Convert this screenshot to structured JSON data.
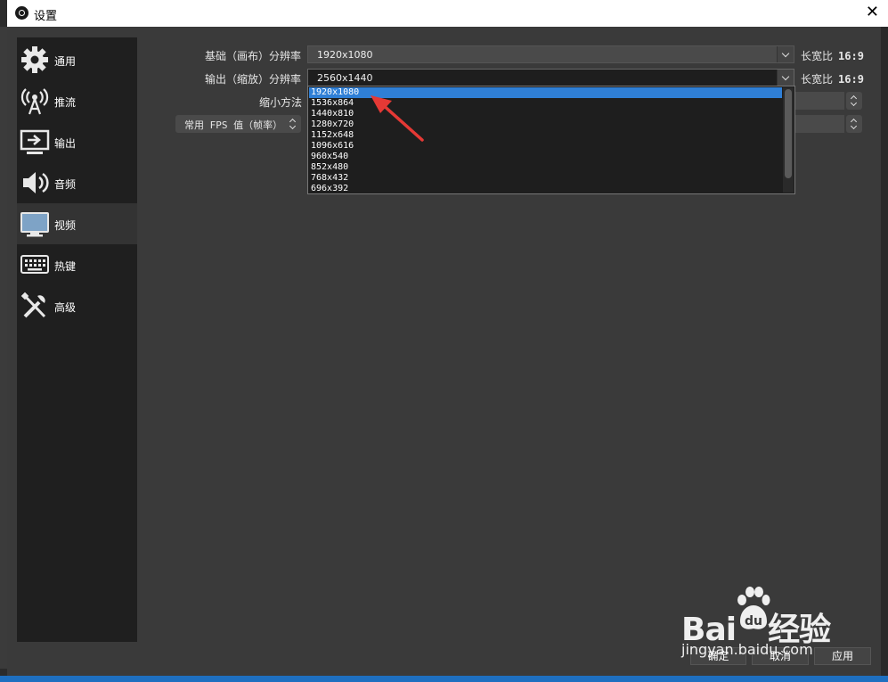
{
  "window": {
    "title": "设置"
  },
  "sidebar": {
    "items": [
      {
        "label": "通用",
        "icon": "gear-icon"
      },
      {
        "label": "推流",
        "icon": "antenna-icon"
      },
      {
        "label": "输出",
        "icon": "monitor-output-icon"
      },
      {
        "label": "音频",
        "icon": "speaker-icon"
      },
      {
        "label": "视频",
        "icon": "monitor-icon",
        "active": true
      },
      {
        "label": "热键",
        "icon": "keyboard-icon"
      },
      {
        "label": "高级",
        "icon": "tools-icon"
      }
    ]
  },
  "video": {
    "base_label": "基础（画布）分辨率",
    "base_value": "1920x1080",
    "output_label": "输出（缩放）分辨率",
    "output_value": "2560x1440",
    "downscale_label": "缩小方法",
    "fps_label": "常用 FPS 值（帧率）",
    "aspect_label": "长宽比",
    "aspect_base": "16:9",
    "aspect_output": "16:9"
  },
  "dropdown": {
    "options": [
      "1920x1080",
      "1536x864",
      "1440x810",
      "1280x720",
      "1152x648",
      "1096x616",
      "960x540",
      "852x480",
      "768x432",
      "696x392"
    ],
    "selected_index": 0
  },
  "buttons": {
    "ok": "确定",
    "cancel": "取消",
    "apply": "应用"
  },
  "watermark": {
    "brand": "Bai",
    "brand_cn": "经验",
    "url": "jingyan.baidu.com"
  },
  "colors": {
    "selection": "#2f7fd6",
    "arrow": "#e53935"
  }
}
